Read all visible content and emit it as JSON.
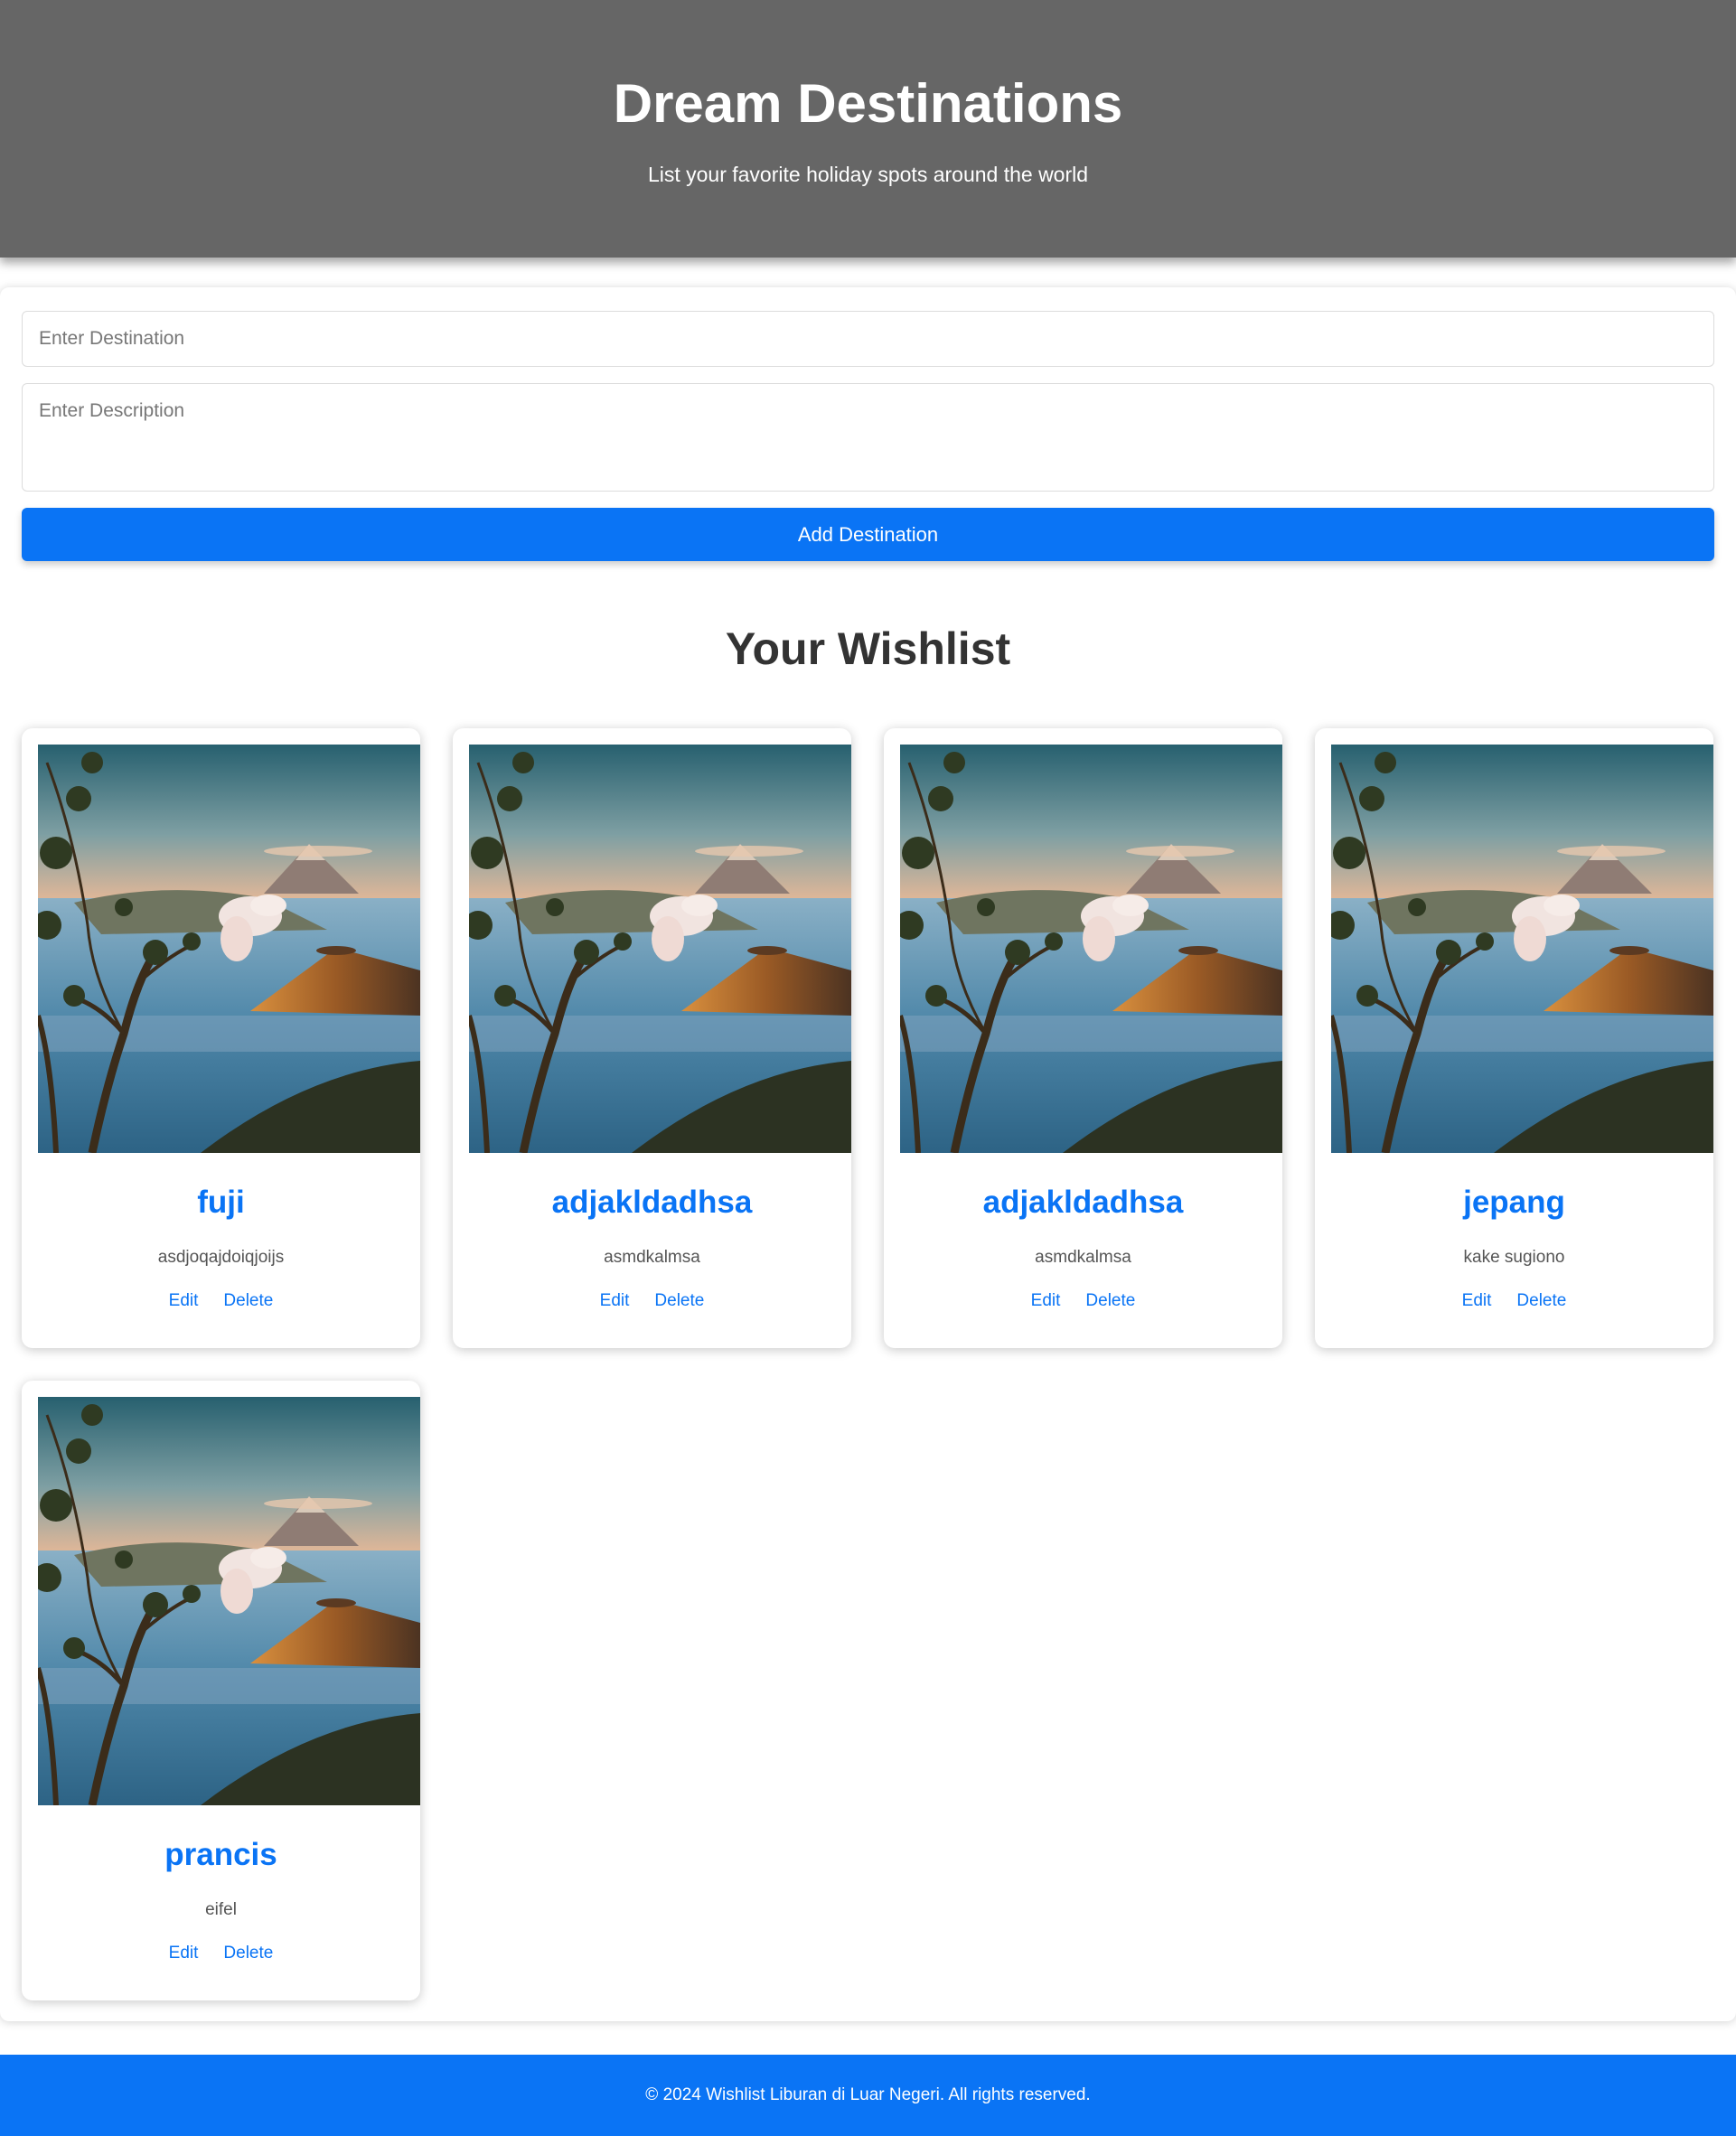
{
  "header": {
    "title": "Dream Destinations",
    "subtitle": "List your favorite holiday spots around the world"
  },
  "form": {
    "destination_placeholder": "Enter Destination",
    "description_placeholder": "Enter Description",
    "add_label": "Add Destination"
  },
  "wishlist": {
    "title": "Your Wishlist",
    "items": [
      {
        "name": "fuji",
        "description": "asdjoqajdoiqjoijs",
        "edit": "Edit",
        "delete": "Delete"
      },
      {
        "name": "adjakldadhsa",
        "description": "asmdkalmsa",
        "edit": "Edit",
        "delete": "Delete"
      },
      {
        "name": "adjakldadhsa",
        "description": "asmdkalmsa",
        "edit": "Edit",
        "delete": "Delete"
      },
      {
        "name": "jepang",
        "description": "kake sugiono",
        "edit": "Edit",
        "delete": "Delete"
      },
      {
        "name": "prancis",
        "description": "eifel",
        "edit": "Edit",
        "delete": "Delete"
      }
    ]
  },
  "footer": {
    "text": "© 2024 Wishlist Liburan di Luar Negeri. All rights reserved."
  },
  "colors": {
    "header_bg": "#666666",
    "accent": "#0a74f5",
    "footer_bg": "#0a74f5"
  }
}
